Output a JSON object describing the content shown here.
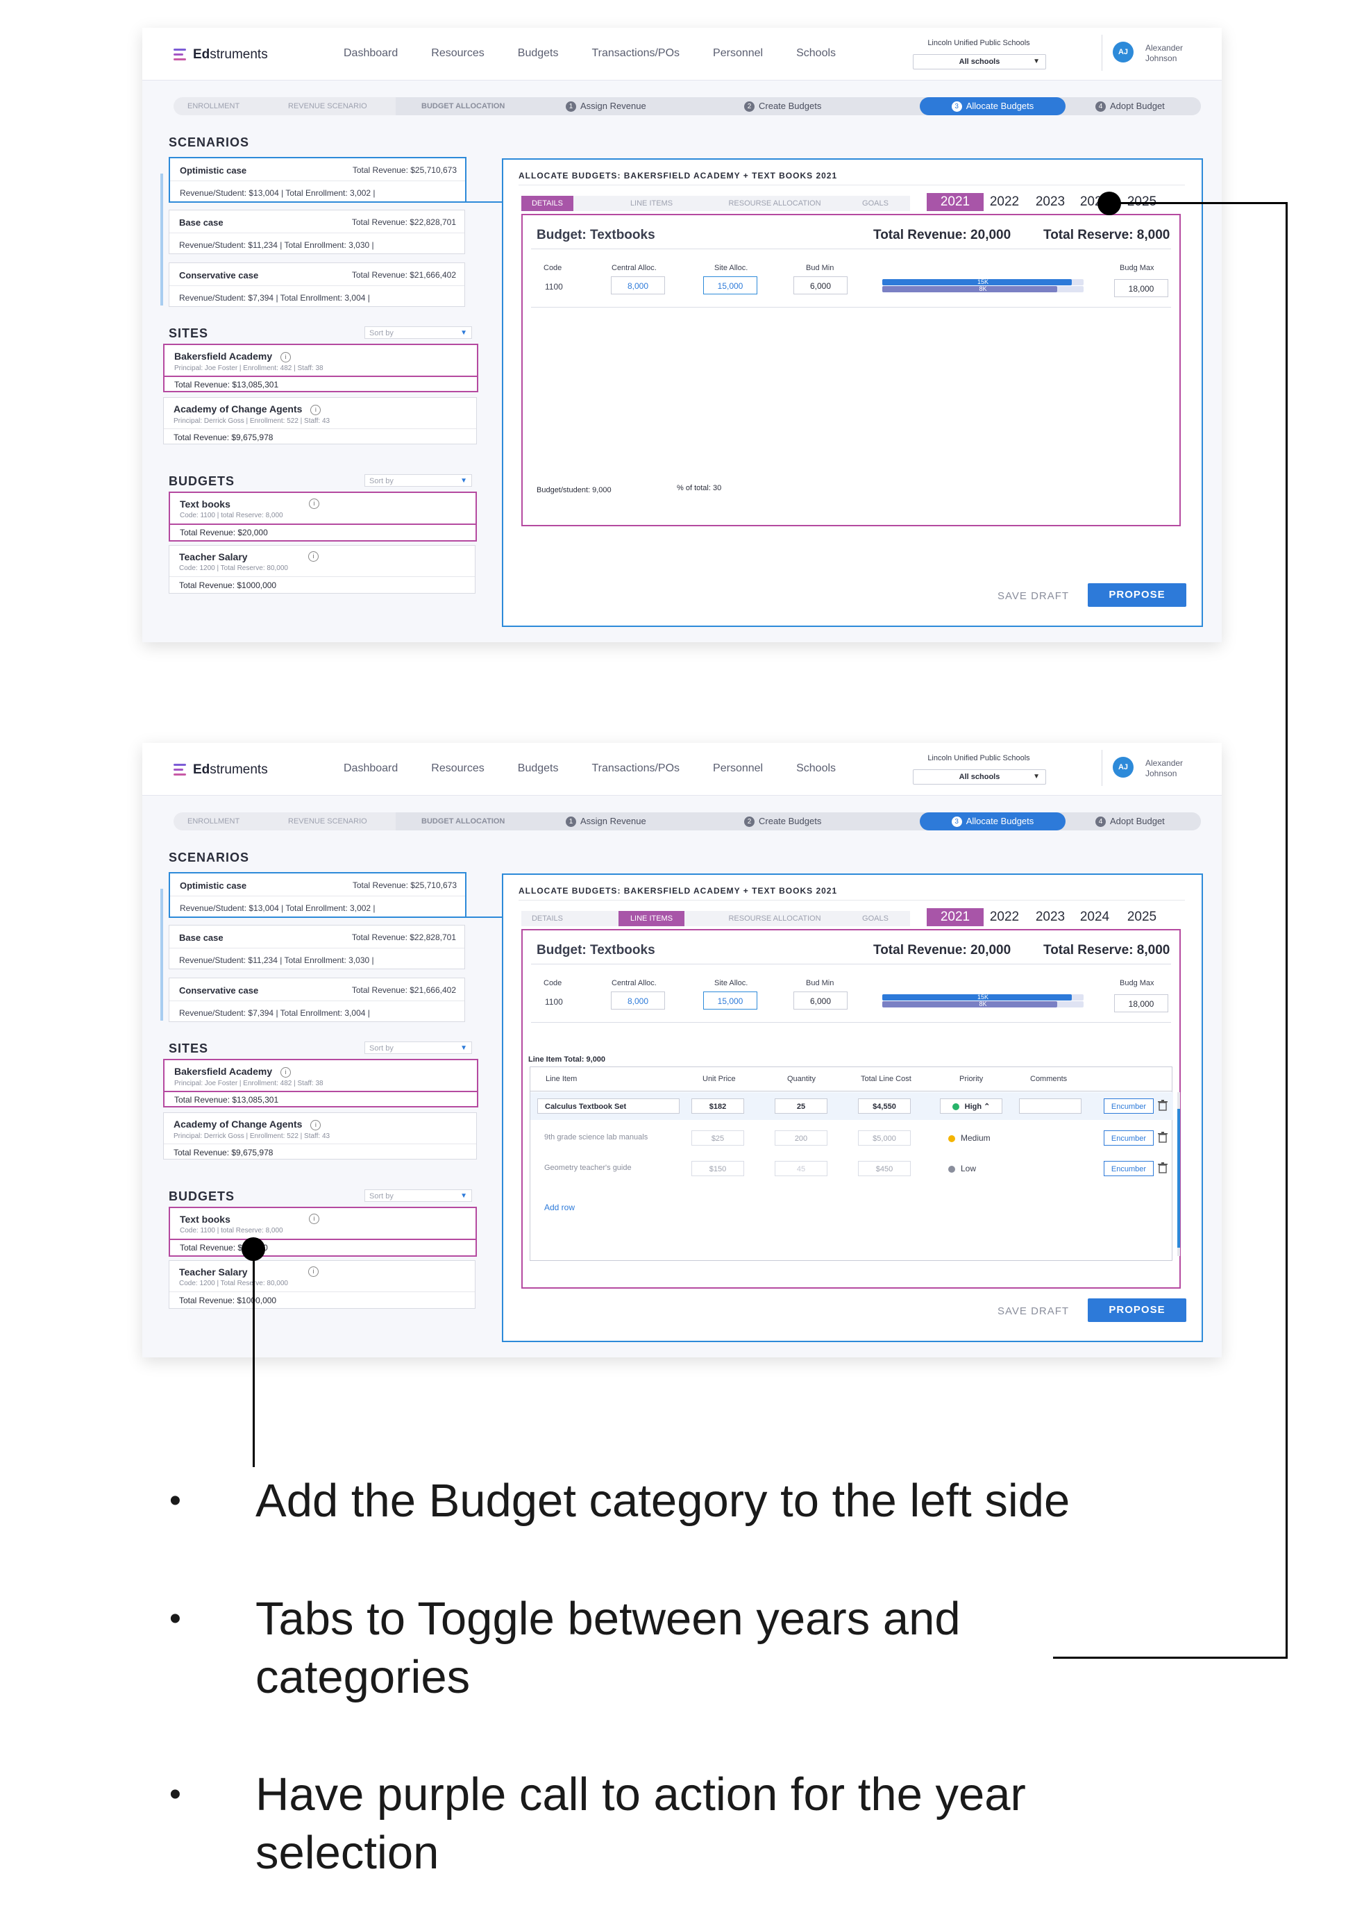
{
  "app": {
    "logo_bold": "Ed",
    "logo_rest": "struments",
    "nav": [
      "Dashboard",
      "Resources",
      "Budgets",
      "Transactions/POs",
      "Personnel",
      "Schools"
    ],
    "district": "Lincoln Unified Public Schools",
    "school_select": "All schools",
    "user_initials": "AJ",
    "user_first": "Alexander",
    "user_last": "Johnson"
  },
  "steps": {
    "enrollment": "ENROLLMENT",
    "revenue": "REVENUE SCENARIO",
    "allocation": "BUDGET ALLOCATION",
    "s1": "Assign Revenue",
    "s2": "Create Budgets",
    "s3": "Allocate Budgets",
    "s4": "Adopt Budget",
    "n1": "1",
    "n2": "2",
    "n3": "3",
    "n4": "4"
  },
  "scenarios": {
    "title": "SCENARIOS",
    "items": [
      {
        "name": "Optimistic case",
        "total": "Total Revenue: $25,710,673",
        "detail": "Revenue/Student:  $13,004   |  Total Enrollment: 3,002   |"
      },
      {
        "name": "Base case",
        "total": "Total Revenue: $22,828,701",
        "detail": "Revenue/Student:  $11,234   |  Total Enrollment: 3,030   |"
      },
      {
        "name": "Conservative case",
        "total": "Total Revenue: $21,666,402",
        "detail": "Revenue/Student:  $7,394   |   Total Enrollment: 3,004   |"
      }
    ]
  },
  "sites": {
    "title": "SITES",
    "sort": "Sort by",
    "items": [
      {
        "name": "Bakersfield Academy",
        "meta": "Principal: Joe Foster   |   Enrollment: 482   |   Staff: 38",
        "total": "Total Revenue:  $13,085,301"
      },
      {
        "name": "Academy of Change Agents",
        "meta": "Principal: Derrick Goss   |   Enrollment: 522   |   Staff: 43",
        "total": "Total Revenue:  $9,675,978"
      }
    ]
  },
  "budgets": {
    "title": "BUDGETS",
    "sort": "Sort by",
    "items": [
      {
        "name": "Text books",
        "meta": "Code: 1100   |   total Reserve: 8,000",
        "total": "Total Revenue:  $20,000"
      },
      {
        "name": "Teacher Salary",
        "meta": "Code: 1200   |   Total Reserve: 80,000",
        "total": "Total Revenue:  $1000,000"
      }
    ]
  },
  "main": {
    "title": "ALLOCATE BUDGETS: BAKERSFIELD ACADEMY + TEXT BOOKS 2021",
    "tabs": [
      "DETAILS",
      "LINE ITEMS",
      "RESOURSE ALLOCATION",
      "GOALS"
    ],
    "years": [
      "2021",
      "2022",
      "2023",
      "2024",
      "2025"
    ],
    "budget_title": "Budget: Textbooks",
    "total_revenue": "Total Revenue: 20,000",
    "total_reserve": "Total Reserve: 8,000",
    "col_code": "Code",
    "col_central": "Central Alloc.",
    "col_site": "Site Alloc.",
    "col_budmin": "Bud Min",
    "col_budmax": "Budg Max",
    "code": "1100",
    "central": "8,000",
    "site": "15,000",
    "budmin": "6,000",
    "budmax": "18,000",
    "bar1": "15K",
    "bar2": "8K",
    "bar1_fraction": 0.94,
    "bar2_fraction": 0.87,
    "per_student": "Budget/student: 9,000",
    "pct_total": "% of total: 30",
    "save": "SAVE DRAFT",
    "propose": "PROPOSE"
  },
  "lineitems": {
    "total": "Line Item Total: 9,000",
    "headers": [
      "Line Item",
      "Unit Price",
      "Quantity",
      "Total Line Cost",
      "Priority",
      "Comments"
    ],
    "rows": [
      {
        "item": "Calculus Textbook Set",
        "price": "$182",
        "qty": "25",
        "cost": "$4,550",
        "priority": "High",
        "encumber": "Encumber"
      },
      {
        "item": "9th grade science lab manuals",
        "price": "$25",
        "qty": "200",
        "cost": "$5,000",
        "priority": "Medium",
        "encumber": "Encumber"
      },
      {
        "item": "Geometry teacher's guide",
        "price": "$150",
        "qty": "45",
        "cost": "$450",
        "priority": "Low",
        "encumber": "Encumber"
      }
    ],
    "add_row": "Add row",
    "priority_colors": {
      "high": "#27b36a",
      "medium": "#f4b400",
      "low": "#8a8e9c"
    }
  },
  "notes": [
    "Add the Budget category to the left side",
    "Tabs to Toggle between years and categories",
    "Have purple call to action for the year selection"
  ],
  "colors": {
    "accent_blue": "#2d7ad9",
    "accent_purple": "#a855a8",
    "pink_border": "#b54aa0"
  }
}
